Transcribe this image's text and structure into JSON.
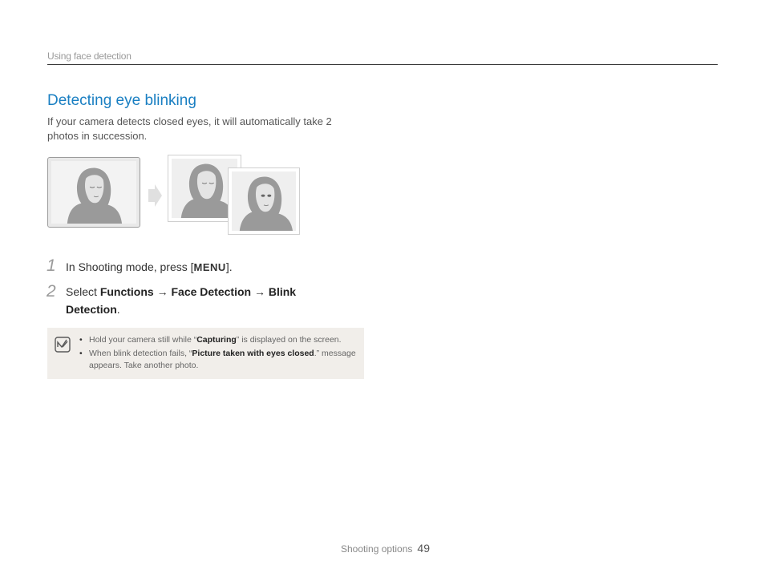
{
  "header": {
    "section": "Using face detection"
  },
  "title": "Detecting eye blinking",
  "intro": "If your camera detects closed eyes, it will automatically take 2 photos in succession.",
  "images": [
    "face-eyes-closed",
    "face-photo-1",
    "face-photo-2"
  ],
  "steps": [
    {
      "num": "1",
      "prefix": "In Shooting mode, press [",
      "key": "MENU",
      "suffix": "]."
    },
    {
      "num": "2",
      "prefix": "Select ",
      "item1": "Functions",
      "arrow1": " → ",
      "item2": "Face Detection",
      "arrow2": " → ",
      "item3": "Blink Detection",
      "suffix": "."
    }
  ],
  "notes": [
    {
      "pre": "Hold your camera still while “",
      "bold": "Capturing",
      "post": "” is displayed on the screen."
    },
    {
      "pre": "When blink detection fails, “",
      "bold": "Picture taken with eyes closed",
      "post": ".” message appears. Take another photo."
    }
  ],
  "footer": {
    "label": "Shooting options",
    "page": "49"
  }
}
